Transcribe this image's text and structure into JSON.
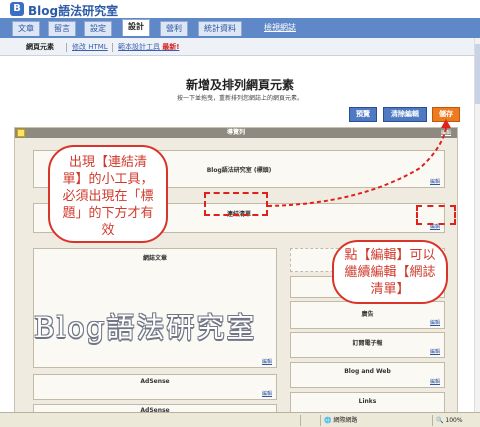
{
  "app": {
    "title": "Blog語法研究室",
    "logo_glyph": "B"
  },
  "tabs": [
    {
      "label": "文章"
    },
    {
      "label": "留言"
    },
    {
      "label": "設定"
    },
    {
      "label": "設計",
      "active": true
    },
    {
      "label": "營利"
    },
    {
      "label": "統計資料"
    }
  ],
  "view_blog_link": "檢視網誌",
  "subtabs": {
    "page_elements": "網頁元素",
    "edit_html": "修改 HTML",
    "template_designer": "範本設計工具",
    "new_badge": "最新!"
  },
  "page": {
    "title": "新增及排列網頁元素",
    "subtitle": "按一下並拖曳，重新排列您網誌上的網頁元素。"
  },
  "buttons": {
    "preview": "預覽",
    "clear_edits": "清除編輯",
    "save": "儲存"
  },
  "layout": {
    "navbar_label": "導覽列",
    "edit_label": "編輯",
    "header_gadget": "Blog語法研究室 (標頭)",
    "linklist_gadget": "連結清單",
    "posts_gadget": "網誌文章",
    "left_gadgets": [
      "AdSense",
      "AdSense"
    ],
    "sidebar_gadgets": [
      "廣告",
      "訂閱電子報",
      "Blog and Web",
      "Links"
    ]
  },
  "callouts": {
    "left": "出現【連結清單】的小工具，必須出現在「標題」的下方才有效",
    "right": "點【編輯】可以繼續編輯【網誌清單】"
  },
  "watermark": "Blog語法研究室",
  "status": {
    "zone": "網際網路",
    "zoom": "100%"
  },
  "colors": {
    "tab_bar": "#5f88c9",
    "save_button": "#ef7b20",
    "callout_red": "#d8342a"
  }
}
